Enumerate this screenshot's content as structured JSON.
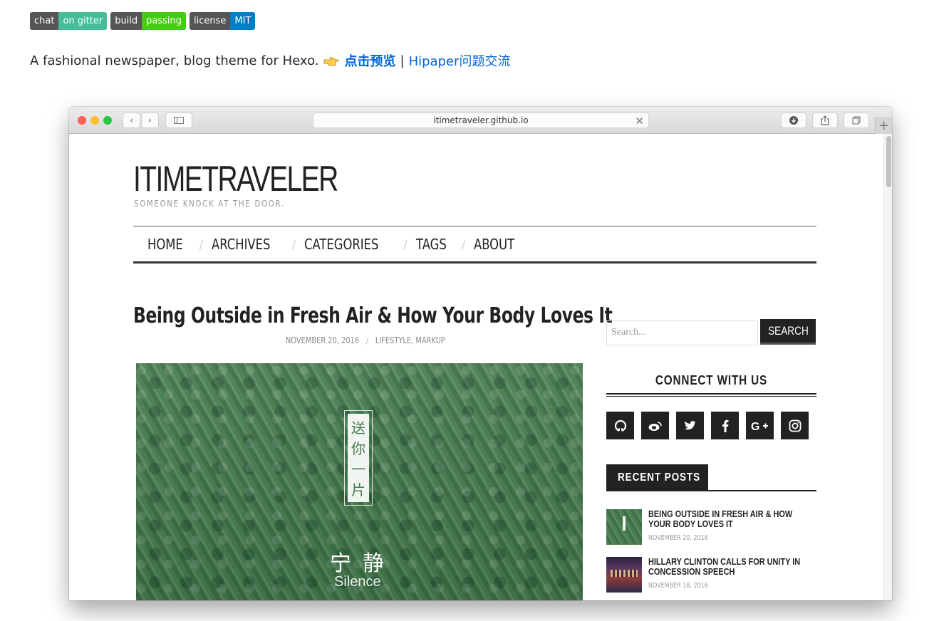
{
  "badges": [
    {
      "left": "chat",
      "right": "on gitter",
      "color": "#46bc99"
    },
    {
      "left": "build",
      "right": "passing",
      "color": "#4c1"
    },
    {
      "left": "license",
      "right": "MIT",
      "color": "#007ec6"
    }
  ],
  "intro": {
    "text": "A fashional newspaper, blog theme for Hexo.",
    "preview_link": "点击预览",
    "separator": "|",
    "issue_link": "Hipaper问题交流"
  },
  "browser": {
    "url": "itimetraveler.github.io"
  },
  "site": {
    "title": "ITIMETRAVELER",
    "tagline": "SOMEONE KNOCK AT THE DOOR.",
    "nav": [
      "HOME",
      "ARCHIVES",
      "CATEGORIES",
      "TAGS",
      "ABOUT"
    ],
    "nav_separator": "/"
  },
  "post": {
    "title": "Being Outside in Fresh Air & How Your Body Loves It",
    "date": "NOVEMBER 20, 2016",
    "meta_separator": "/",
    "categories": "LIFESTYLE, MARKUP",
    "image_text": {
      "vertical": [
        "送",
        "你",
        "一",
        "片"
      ],
      "big": "宁静",
      "small": "Silence"
    }
  },
  "sidebar": {
    "search_placeholder": "Search...",
    "search_button": "SEARCH",
    "connect_title": "CONNECT WITH US",
    "social": [
      {
        "icon": "github-icon",
        "glyph": "⌥"
      },
      {
        "icon": "weibo-icon",
        "glyph": "◎"
      },
      {
        "icon": "twitter-icon",
        "glyph": "✦"
      },
      {
        "icon": "facebook-icon",
        "glyph": "f"
      },
      {
        "icon": "google-plus-icon",
        "glyph": "G+"
      },
      {
        "icon": "instagram-icon",
        "glyph": "◻"
      }
    ],
    "recent_title": "RECENT POSTS",
    "recent_posts": [
      {
        "title": "BEING OUTSIDE IN FRESH AIR & HOW YOUR BODY LOVES IT",
        "date": "NOVEMBER 20, 2016"
      },
      {
        "title": "HILLARY CLINTON CALLS FOR UNITY IN CONCESSION SPEECH",
        "date": "NOVEMBER 18, 2016"
      }
    ]
  }
}
